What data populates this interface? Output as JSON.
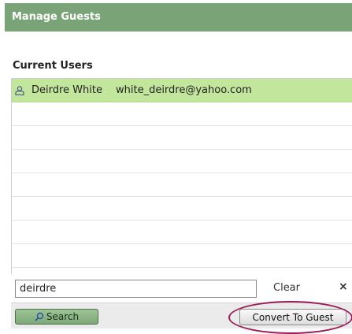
{
  "colors": {
    "header_bg": "#7aa477",
    "selected_row_bg": "#c2e69b",
    "search_button_bg": "#8db785",
    "highlight_ring": "#9c1b59"
  },
  "header": {
    "title": "Manage Guests"
  },
  "current_users": {
    "title": "Current Users",
    "rows": [
      {
        "icon": "user-icon",
        "name": "Deirdre White",
        "email": "white_deirdre@yahoo.com",
        "selected": true
      }
    ],
    "empty_rows": 7
  },
  "search": {
    "value": "deirdre",
    "clear_label": "Clear",
    "close_label": "×",
    "button_label": "Search",
    "button_icon": "search-icon"
  },
  "actions": {
    "convert_label": "Convert To Guest"
  }
}
